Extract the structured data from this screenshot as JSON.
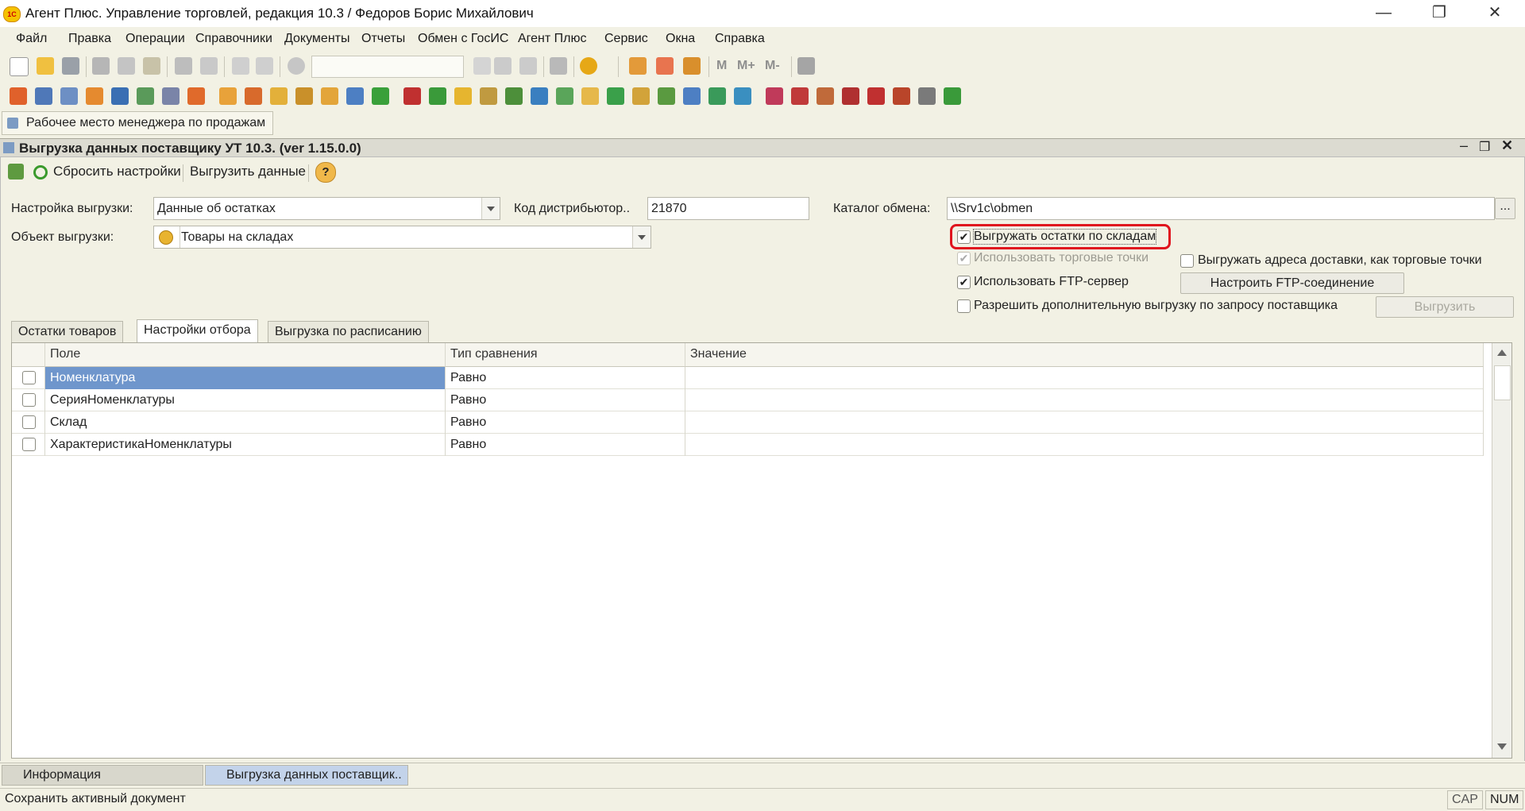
{
  "window": {
    "title": "Агент Плюс. Управление торговлей, редакция 10.3 / Федоров Борис Михайлович",
    "logo": "1С",
    "minimize": "—",
    "restore": "❐",
    "close": "✕"
  },
  "menu": [
    "Файл",
    "Правка",
    "Операции",
    "Справочники",
    "Документы",
    "Отчеты",
    "Обмен с ГосИС",
    "Агент Плюс",
    "Сервис",
    "Окна",
    "Справка"
  ],
  "toolbar": {
    "search_value": "",
    "icons_row1": [
      "new-doc-icon",
      "open-icon",
      "save-icon",
      "cut-icon",
      "copy-icon",
      "paste-icon",
      "print-icon",
      "print-preview-icon",
      "undo-icon",
      "redo-icon",
      "find-icon",
      "clear-icon",
      "history-back-icon",
      "history-forward-icon",
      "windows-icon",
      "info-icon",
      "calculator-icon",
      "calendar-icon",
      "users-icon",
      "memory-m",
      "memory-mplus",
      "memory-mminus",
      "tools-icon"
    ],
    "memory_labels": [
      "M",
      "M+",
      "M-"
    ]
  },
  "workspace_tab": {
    "label": "Рабочее место менеджера по продажам"
  },
  "document": {
    "title": "Выгрузка данных поставщику УТ 10.3. (ver 1.15.0.0)",
    "commands": {
      "reset": "Сбросить настройки",
      "export": "Выгрузить данные",
      "help": "?"
    },
    "form": {
      "settings_label": "Настройка выгрузки:",
      "settings_value": "Данные об остатках",
      "distributor_label": "Код дистрибьютор..",
      "distributor_value": "21870",
      "catalog_label": "Каталог обмена:",
      "catalog_value": "\\\\Srv1c\\obmen",
      "catalog_btn": "...",
      "object_label": "Объект выгрузки:",
      "object_value": "Товары на складах",
      "chk_stock_by_wh": "Выгружать остатки по складам",
      "chk_use_points": "Использовать торговые точки",
      "chk_delivery_addr": "Выгружать адреса доставки, как торговые точки",
      "chk_use_ftp": "Использовать FTP-сервер",
      "ftp_btn": "Настроить FTP-соединение",
      "chk_allow_extra": "Разрешить дополнительную выгрузку по запросу поставщика",
      "export_btn": "Выгрузить",
      "checks": {
        "stock_by_wh": true,
        "use_points": true,
        "delivery_addr": false,
        "use_ftp": true,
        "allow_extra": false
      }
    },
    "tabs": [
      "Остатки товаров",
      "Настройки отбора",
      "Выгрузка по расписанию"
    ],
    "grid": {
      "columns": [
        "Поле",
        "Тип сравнения",
        "Значение"
      ],
      "rows": [
        {
          "field": "Номенклатура",
          "cmp": "Равно",
          "value": ""
        },
        {
          "field": "СерияНоменклатуры",
          "cmp": "Равно",
          "value": ""
        },
        {
          "field": "Склад",
          "cmp": "Равно",
          "value": ""
        },
        {
          "field": "ХарактеристикаНоменклатуры",
          "cmp": "Равно",
          "value": ""
        }
      ]
    }
  },
  "taskbar": [
    "Информация",
    "Выгрузка данных поставщик.."
  ],
  "status": {
    "text": "Сохранить активный документ",
    "cap": "CAP",
    "num": "NUM"
  },
  "colors": {
    "selection": "#6f96cc",
    "highlight_ring": "#e0141e",
    "accent_orange": "#e98a1c"
  }
}
